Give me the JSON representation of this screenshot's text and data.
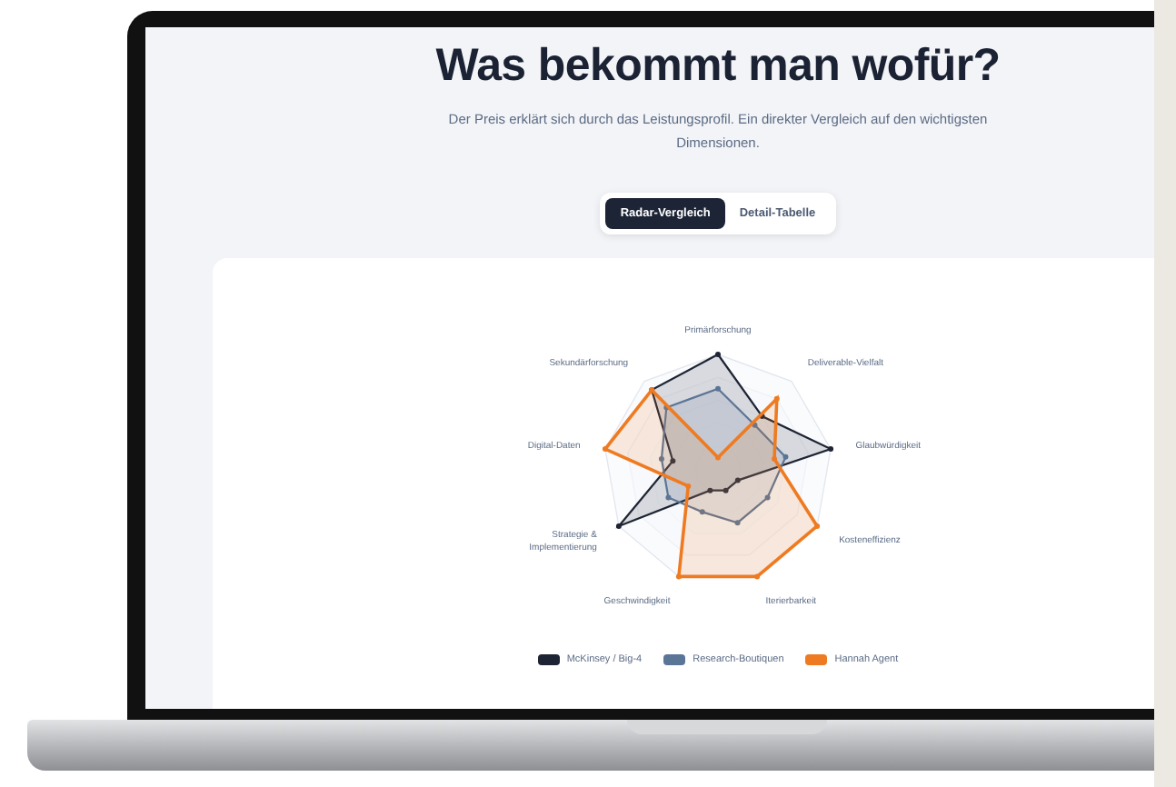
{
  "title": "Was bekommt man wofür?",
  "subtitle": "Der Preis erklärt sich durch das Leistungsprofil. Ein direkter Vergleich auf den wichtigsten Dimensionen.",
  "tabs": [
    {
      "label": "Radar-Vergleich",
      "selected": true
    },
    {
      "label": "Detail-Tabelle",
      "selected": false
    }
  ],
  "radar": {
    "axes": [
      "Primärforschung",
      "Sekundärforschung",
      "Deliverable-Vielfalt",
      "Digital-Daten",
      "Glaubwürdigkeit",
      "Strategie & Implementierung",
      "Kosteneffizienz",
      "Geschwindigkeit",
      "Iterierbarkeit"
    ]
  },
  "legend": [
    {
      "label": "McKinsey / Big-4",
      "color": "#1e2433"
    },
    {
      "label": "Research-Boutiquen",
      "color": "#5b7596"
    },
    {
      "label": "Hannah Agent",
      "color": "#ee7b22"
    }
  ]
}
